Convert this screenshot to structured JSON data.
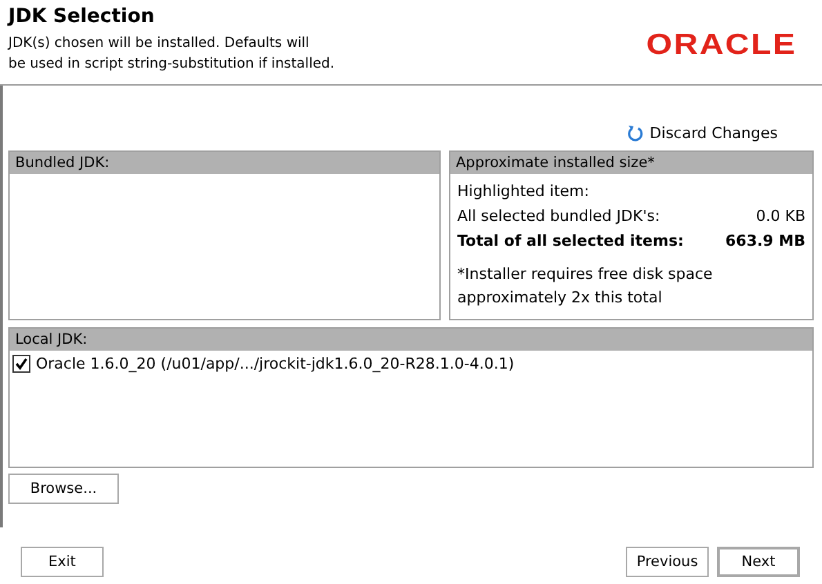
{
  "header": {
    "title": "JDK Selection",
    "description": [
      "JDK(s) chosen will be installed.  Defaults will",
      "be used in script string-substitution if installed."
    ],
    "logo": "ORACLE"
  },
  "discard": {
    "label": "Discard Changes"
  },
  "bundled": {
    "title": "Bundled JDK:"
  },
  "size": {
    "title": "Approximate installed size*",
    "rows": [
      {
        "label": "Highlighted item:",
        "value": null,
        "bold": false
      },
      {
        "label": "All selected bundled JDK's:",
        "value": "0.0 KB",
        "bold": false
      },
      {
        "label": "Total of all selected items:",
        "value": "663.9 MB",
        "bold": true
      }
    ],
    "note": [
      "*Installer requires free disk space",
      "approximately 2x this total"
    ]
  },
  "local": {
    "title": "Local JDK:",
    "items": [
      {
        "label": "Oracle 1.6.0_20 (/u01/app/.../jrockit-jdk1.6.0_20-R28.1.0-4.0.1)",
        "checked": true
      }
    ]
  },
  "browse": {
    "label": "Browse..."
  },
  "footer": {
    "left": [
      {
        "label": "Exit",
        "default": false
      }
    ],
    "right": [
      {
        "label": "Previous",
        "default": false
      },
      {
        "label": "Next",
        "default": true
      }
    ]
  }
}
